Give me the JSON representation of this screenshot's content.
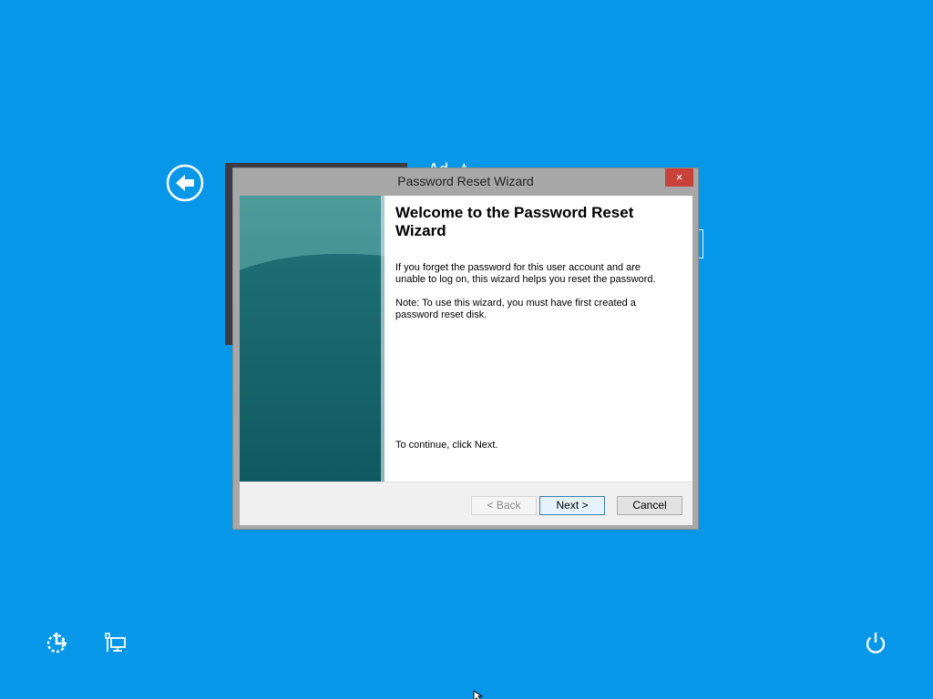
{
  "background_color": "#0797e8",
  "lock_screen": {
    "back_icon": "back-arrow-icon",
    "username_partial": "Ad...t"
  },
  "dialog": {
    "title": "Password Reset Wizard",
    "close_label": "×",
    "heading": "Welcome to the Password Reset Wizard",
    "paragraph1": "If you forget the password for this user account and are unable to log on, this wizard helps you reset the password.",
    "paragraph2": "Note: To use this wizard, you must have first created a password reset disk.",
    "continue_text": "To continue, click Next.",
    "buttons": {
      "back": "< Back",
      "next": "Next >",
      "cancel": "Cancel"
    },
    "back_enabled": false,
    "colors": {
      "close": "#c7423a",
      "side_panel": "#2c7c80"
    }
  },
  "bottom_bar": {
    "left_icons": [
      "ease-of-access-icon",
      "network-icon"
    ],
    "right_icons": [
      "power-icon"
    ]
  }
}
